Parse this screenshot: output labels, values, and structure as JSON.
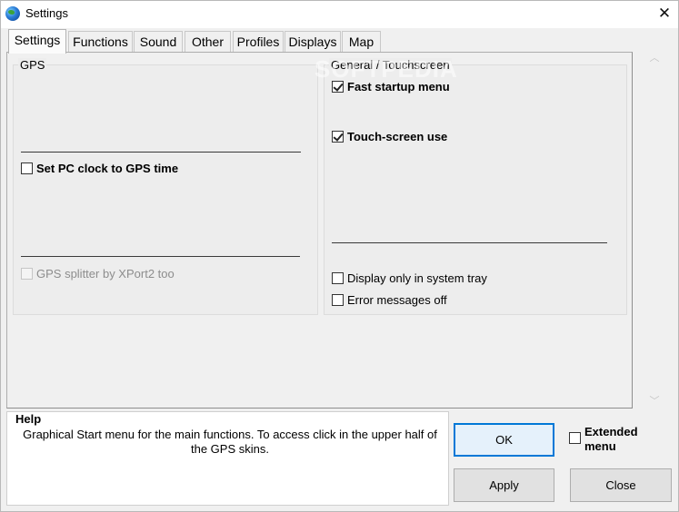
{
  "window": {
    "title": "Settings",
    "close_glyph": "✕"
  },
  "tabs": [
    {
      "label": "Settings",
      "active": true
    },
    {
      "label": "Functions",
      "active": false
    },
    {
      "label": "Sound",
      "active": false
    },
    {
      "label": "Other",
      "active": false
    },
    {
      "label": "Profiles",
      "active": false
    },
    {
      "label": "Displays",
      "active": false
    },
    {
      "label": "Map",
      "active": false
    }
  ],
  "gps": {
    "label": "GPS",
    "set_clock": {
      "label": "Set PC clock to GPS time",
      "checked": false
    },
    "splitter": {
      "label": "GPS splitter by XPort2 too",
      "checked": false,
      "disabled": true
    }
  },
  "general": {
    "label": "General / Touchscreen",
    "fast_startup": {
      "label": "Fast startup menu",
      "checked": true
    },
    "touch_screen": {
      "label": "Touch-screen use",
      "checked": true
    },
    "system_tray": {
      "label": "Display only in system tray",
      "checked": false
    },
    "error_off": {
      "label": "Error messages off",
      "checked": false
    }
  },
  "watermark": "SOFTPEDIA",
  "scroll": {
    "up_glyph": "︿",
    "down_glyph": "﹀"
  },
  "help": {
    "label": "Help",
    "text": "Graphical Start menu for the main functions. To access click in the upper half of the GPS skins."
  },
  "buttons": {
    "ok": "OK",
    "apply": "Apply",
    "close": "Close"
  },
  "extended": {
    "label_line1": "Extended",
    "label_line2": "menu",
    "checked": false
  },
  "colors": {
    "accent": "#0078d7",
    "window_bg": "#f0f0f0"
  },
  "icons": {
    "app": "globe-icon"
  }
}
